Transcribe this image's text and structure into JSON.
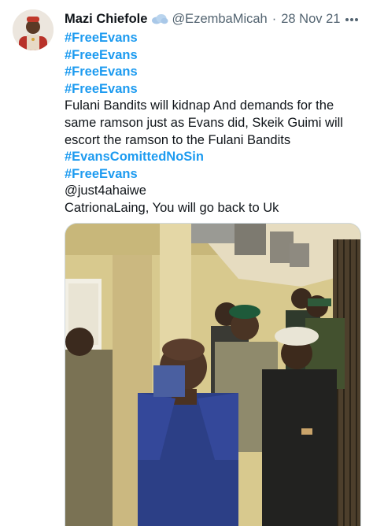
{
  "tweet": {
    "author_name": "Mazi Chiefole",
    "handle": "@EzembaMicah",
    "separator": "·",
    "date": "28 Nov 21",
    "badge_icon": "cloud-icon",
    "lines": [
      {
        "text": "#FreeEvans",
        "kind": "hashtag"
      },
      {
        "text": "#FreeEvans",
        "kind": "hashtag"
      },
      {
        "text": "#FreeEvans",
        "kind": "hashtag"
      },
      {
        "text": "#FreeEvans",
        "kind": "hashtag"
      },
      {
        "text": "Fulani Bandits will kidnap And demands for the",
        "kind": "text"
      },
      {
        "text": "same ramson just as Evans did, Skeik Guimi will",
        "kind": "text"
      },
      {
        "text": "escort the ramson to the Fulani Bandits",
        "kind": "text"
      },
      {
        "text": "#EvansComittedNoSin",
        "kind": "hashtag"
      },
      {
        "text": "#FreeEvans",
        "kind": "hashtag"
      },
      {
        "text": "@just4ahaiwe",
        "kind": "mention"
      },
      {
        "text": "CatrionaLaing, You will go back to Uk",
        "kind": "text"
      }
    ]
  },
  "colors": {
    "link": "#1d9bf0",
    "secondary_text": "#536471",
    "primary_text": "#0f1419"
  },
  "icons": {
    "more": "more-options-icon",
    "avatar": "avatar-photo"
  }
}
